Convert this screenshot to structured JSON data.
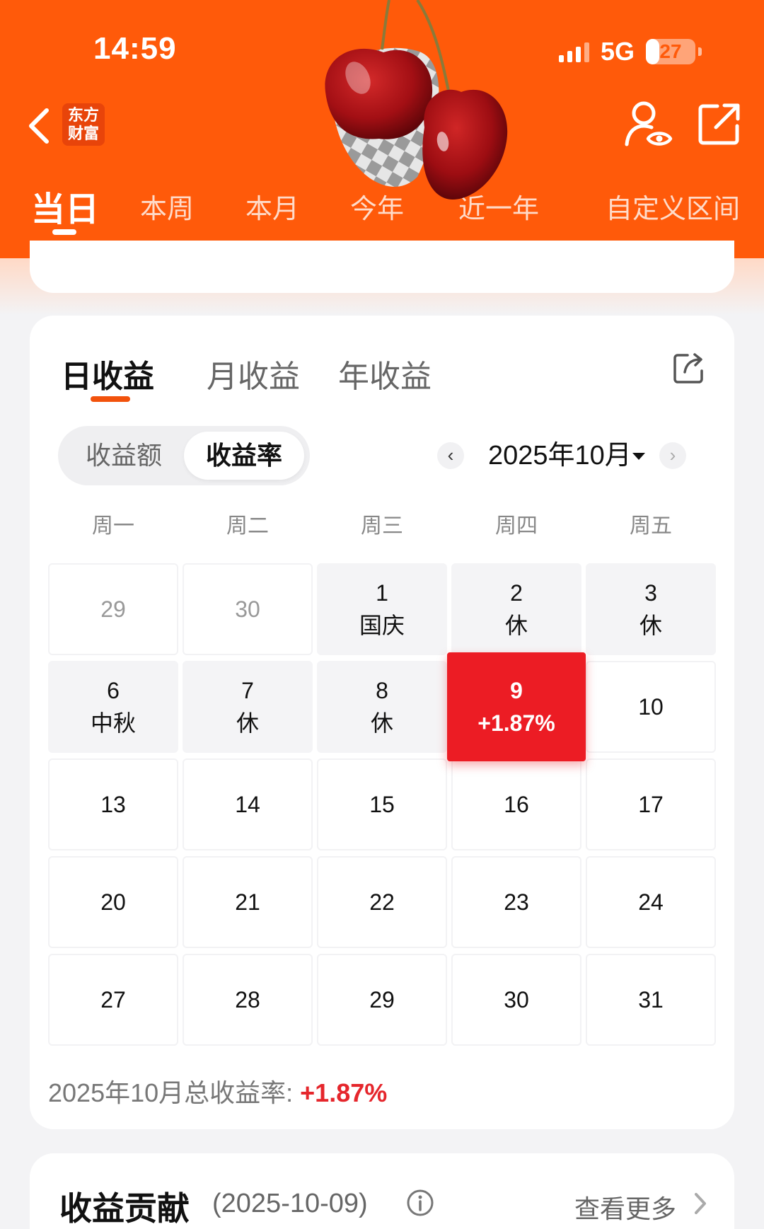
{
  "status": {
    "time": "14:59",
    "network": "5G",
    "battery": "27",
    "battery_level": 0.27
  },
  "header": {
    "logo_line1": "东方",
    "logo_line2": "财富",
    "tabs": [
      "当日",
      "本周",
      "本月",
      "今年",
      "近一年",
      "自定义区间"
    ],
    "active_tab": "当日",
    "colors": {
      "brand": "#ff5a0a"
    }
  },
  "calendar_card": {
    "tabs": [
      "日收益",
      "月收益",
      "年收益"
    ],
    "active_tab": "日收益",
    "toggle": [
      "收益额",
      "收益率"
    ],
    "toggle_selected": "收益率",
    "month_label": "2025年10月",
    "weekdays": [
      "周一",
      "周二",
      "周三",
      "周四",
      "周五"
    ],
    "rows": [
      [
        {
          "day": "29",
          "sub": "",
          "type": "other"
        },
        {
          "day": "30",
          "sub": "",
          "type": "other"
        },
        {
          "day": "1",
          "sub": "国庆",
          "type": "holiday"
        },
        {
          "day": "2",
          "sub": "休",
          "type": "holiday"
        },
        {
          "day": "3",
          "sub": "休",
          "type": "holiday"
        }
      ],
      [
        {
          "day": "6",
          "sub": "中秋",
          "type": "holiday"
        },
        {
          "day": "7",
          "sub": "休",
          "type": "holiday"
        },
        {
          "day": "8",
          "sub": "休",
          "type": "holiday"
        },
        {
          "day": "9",
          "sub": "+1.87%",
          "type": "today"
        },
        {
          "day": "10",
          "sub": "",
          "type": "normal"
        }
      ],
      [
        {
          "day": "13",
          "sub": "",
          "type": "normal"
        },
        {
          "day": "14",
          "sub": "",
          "type": "normal"
        },
        {
          "day": "15",
          "sub": "",
          "type": "normal"
        },
        {
          "day": "16",
          "sub": "",
          "type": "normal"
        },
        {
          "day": "17",
          "sub": "",
          "type": "normal"
        }
      ],
      [
        {
          "day": "20",
          "sub": "",
          "type": "normal"
        },
        {
          "day": "21",
          "sub": "",
          "type": "normal"
        },
        {
          "day": "22",
          "sub": "",
          "type": "normal"
        },
        {
          "day": "23",
          "sub": "",
          "type": "normal"
        },
        {
          "day": "24",
          "sub": "",
          "type": "normal"
        }
      ],
      [
        {
          "day": "27",
          "sub": "",
          "type": "normal"
        },
        {
          "day": "28",
          "sub": "",
          "type": "normal"
        },
        {
          "day": "29",
          "sub": "",
          "type": "normal"
        },
        {
          "day": "30",
          "sub": "",
          "type": "normal"
        },
        {
          "day": "31",
          "sub": "",
          "type": "normal"
        }
      ]
    ],
    "total_label": "2025年10月总收益率:",
    "total_value": "+1.87%",
    "colors": {
      "accent": "#f2520c",
      "positive": "#e5262c",
      "today_bg": "#ec1c24"
    }
  },
  "contribution": {
    "title": "收益贡献",
    "date": "(2025-10-09)",
    "more": "查看更多"
  },
  "icons": [
    "chevron-left-icon",
    "user-eye-icon",
    "share-icon",
    "cherry-sticker",
    "info-icon",
    "chevron-right-icon",
    "chevron-down-icon"
  ]
}
